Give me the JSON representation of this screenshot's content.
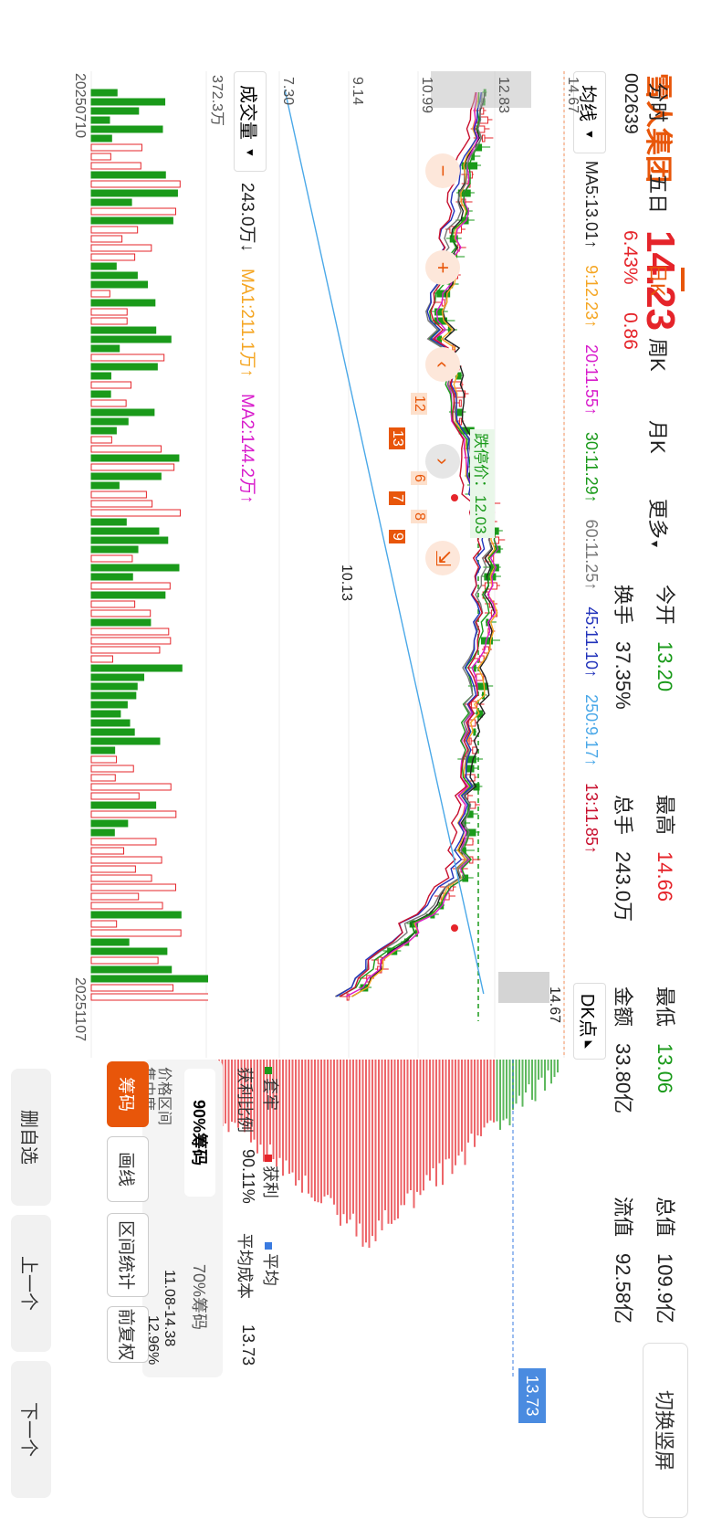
{
  "stock": {
    "name": "雪人集团",
    "code": "002639",
    "price": "14.23",
    "change_pct": "6.43%",
    "change_abs": "0.86"
  },
  "stats": [
    {
      "label": "今开",
      "value": "13.20",
      "color": "green"
    },
    {
      "label": "最高",
      "value": "14.66",
      "color": "red"
    },
    {
      "label": "最低",
      "value": "13.06",
      "color": "green"
    },
    {
      "label": "总值",
      "value": "109.9亿",
      "color": "dark"
    },
    {
      "label": "换手",
      "value": "37.35%",
      "color": "dark"
    },
    {
      "label": "总手",
      "value": "243.0万",
      "color": "dark"
    },
    {
      "label": "金额",
      "value": "33.80亿",
      "color": "dark"
    },
    {
      "label": "流值",
      "value": "92.58亿",
      "color": "dark"
    }
  ],
  "switch_label": "切换竖屏",
  "ma_selector": "均线",
  "ma_values": [
    {
      "text": "MA5:13.01↑",
      "color": "#222"
    },
    {
      "text": "9:12.23↑",
      "color": "#f5a623"
    },
    {
      "text": "20:11.55↑",
      "color": "#d81bcb"
    },
    {
      "text": "30:11.29↑",
      "color": "#1a9a1a"
    },
    {
      "text": "60:11.25↑",
      "color": "#777"
    },
    {
      "text": "45:11.10↑",
      "color": "#2233bb"
    },
    {
      "text": "250:9.17↑",
      "color": "#4aa8e8"
    },
    {
      "text": "13:11.85↑",
      "color": "#c8102e"
    }
  ],
  "dk_label": "DK点",
  "price_axis": [
    "14.67",
    "12.83",
    "10.99",
    "9.14",
    "7.30"
  ],
  "limit_down_label": "跌停价：12.03",
  "annotations": {
    "high": "14.67",
    "low": "10.13",
    "nums": [
      "12",
      "13",
      "6",
      "7",
      "8",
      "9"
    ]
  },
  "volume_selector": "成交量",
  "volume_values": [
    {
      "text": "243.0万↓",
      "color": "#222"
    },
    {
      "text": "MA1:211.1万↑",
      "color": "#f5a623"
    },
    {
      "text": "MA2:144.2万↑",
      "color": "#d81bcb"
    }
  ],
  "volume_axis_top": "372.3万",
  "date_start": "20250710",
  "date_end": "20251107",
  "tabs": [
    "分时",
    "五日",
    "日K",
    "周K",
    "月K",
    "更多"
  ],
  "active_tab": "日K",
  "chip_tabs": [
    "筹码",
    "画线",
    "区间统计",
    "前复权"
  ],
  "chip_avg_label": "13.73",
  "legend": [
    {
      "label": "套牢",
      "color": "#1a9a1a"
    },
    {
      "label": "获利",
      "color": "#e5242a"
    },
    {
      "label": "平均",
      "color": "#3a7be0"
    }
  ],
  "profit_ratio_label": "获利比例",
  "profit_ratio": "90.11%",
  "avg_cost_label": "平均成本",
  "avg_cost": "13.73",
  "chip_pct_tabs": [
    "90%筹码",
    "70%筹码"
  ],
  "range_label": "价格区间",
  "range_value": "11.08-14.38",
  "conc_label": "集中度",
  "conc_value": "12.96%",
  "buttons": [
    "删自选",
    "上一个",
    "下一个"
  ],
  "zoom_controls": [
    "minus",
    "plus",
    "left",
    "right",
    "collapse"
  ]
}
